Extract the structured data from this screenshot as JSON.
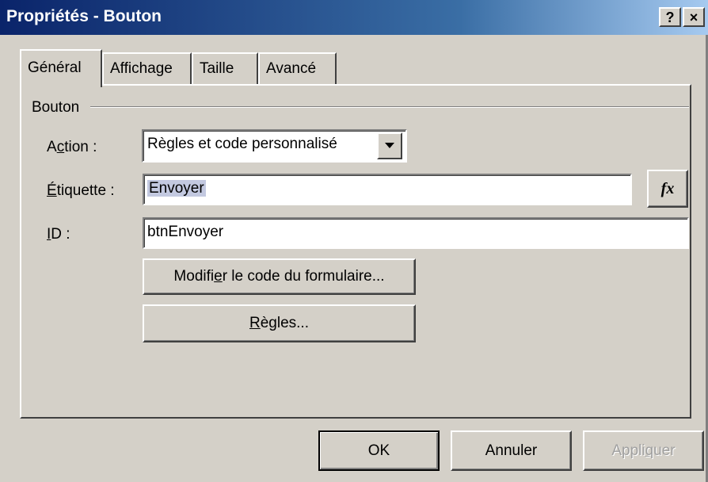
{
  "window": {
    "title": "Propriétés - Bouton",
    "help_label": "?",
    "close_label": "×"
  },
  "tabs": [
    {
      "label": "Général",
      "active": true
    },
    {
      "label": "Affichage",
      "active": false
    },
    {
      "label": "Taille",
      "active": false
    },
    {
      "label": "Avancé",
      "active": false
    }
  ],
  "group": {
    "label": "Bouton"
  },
  "fields": {
    "action": {
      "label_pre": "A",
      "label_accel": "c",
      "label_post": "tion :",
      "value": "Règles et code personnalisé"
    },
    "label": {
      "label_accel": "É",
      "label_post": "tiquette :",
      "value": "Envoyer",
      "fx_label": "fx"
    },
    "id": {
      "label_accel": "I",
      "label_post": "D :",
      "value": "btnEnvoyer"
    }
  },
  "buttons": {
    "edit_code": {
      "pre": "Modifi",
      "accel": "e",
      "post": "r le code du formulaire..."
    },
    "rules": {
      "pre": "",
      "accel": "R",
      "post": "ègles..."
    },
    "ok": "OK",
    "cancel": "Annuler",
    "apply": {
      "pre": "Appli",
      "accel": "q",
      "post": "uer"
    }
  },
  "colors": {
    "title_bar": "#0a246a",
    "face": "#d4d0c8",
    "selection": "#c3c9e0"
  }
}
